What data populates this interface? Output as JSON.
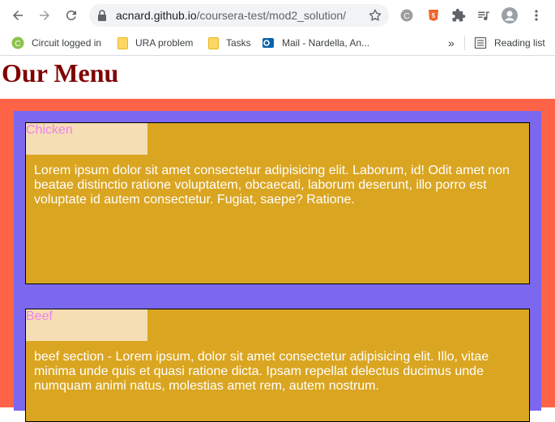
{
  "browser": {
    "url_host": "acnard.github.io",
    "url_path": "/coursera-test/mod2_solution/",
    "bookmarks": [
      {
        "label": "Circuit logged in",
        "icon": "circuit-icon"
      },
      {
        "label": "URA problem",
        "icon": "folder-icon"
      },
      {
        "label": "Tasks",
        "icon": "folder-icon"
      },
      {
        "label": "Mail - Nardella, An...",
        "icon": "outlook-icon"
      }
    ],
    "more_bookmarks": "»",
    "reading_list": "Reading list"
  },
  "page": {
    "title": "Our Menu",
    "sections": [
      {
        "label": "Chicken",
        "text": "Lorem ipsum dolor sit amet consectetur adipisicing elit. Laborum, id! Odit amet non beatae distinctio ratione voluptatem, obcaecati, laborum deserunt, illo porro est voluptate id autem consectetur. Fugiat, saepe? Ratione."
      },
      {
        "label": "Beef",
        "text": "beef section - Lorem ipsum, dolor sit amet consectetur adipisicing elit. Illo, vitae minima unde quis et quasi ratione dicta. Ipsam repellat delectus ducimus unde numquam animi natus, molestias amet rem, autem nostrum."
      }
    ]
  },
  "colors": {
    "title": "#800000",
    "outer_bg": "#ff6347",
    "inner_bg": "#7b68ee",
    "section_bg": "#daa520",
    "label_bg": "#f5deb3",
    "label_text": "#ee82ee"
  }
}
